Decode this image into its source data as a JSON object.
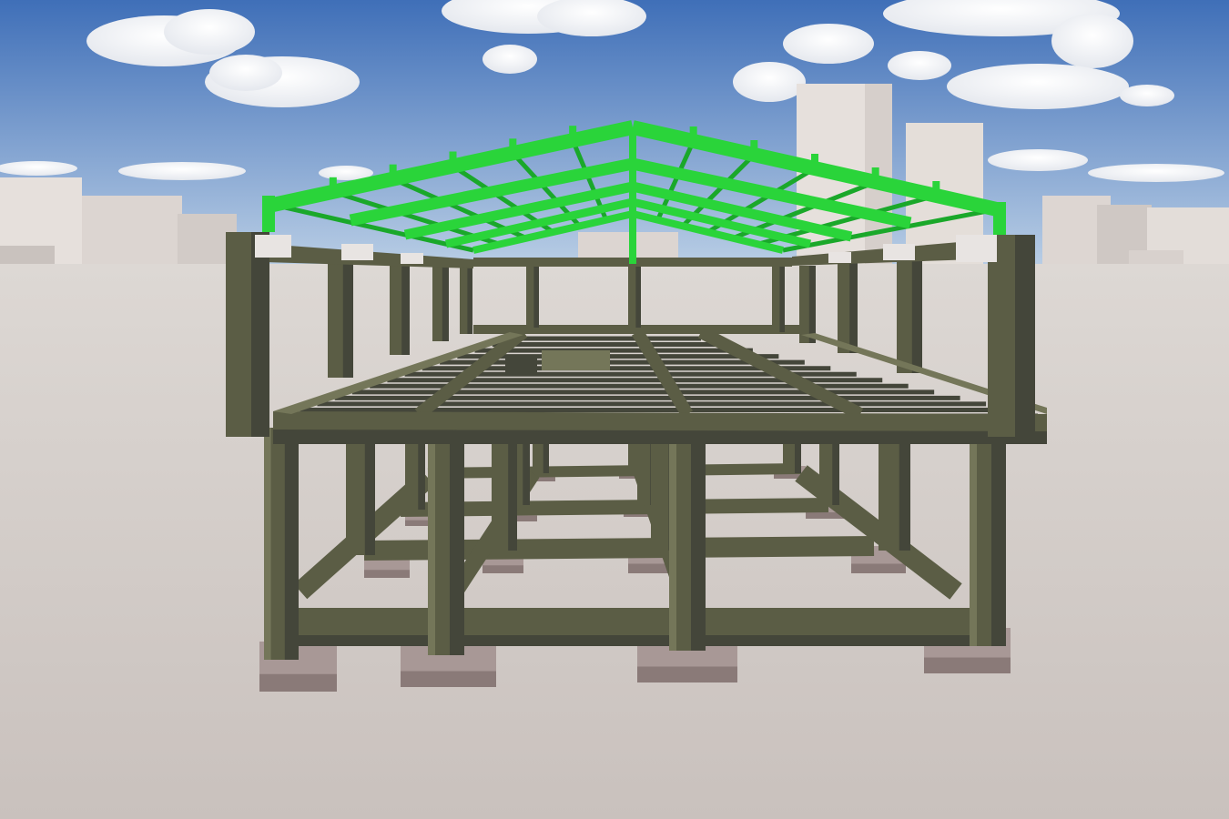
{
  "scene": {
    "colors": {
      "sky_top": "#3f6fb8",
      "sky_bottom": "#bcd0e6",
      "ground": "#c9c1bd",
      "ground_far": "#ddd8d4",
      "concrete": "#5b5d45",
      "concrete_dark": "#44463a",
      "concrete_light": "#747659",
      "footing": "#a89896",
      "footing_dark": "#8a7a78",
      "steel": "#2ad43a",
      "steel_dark": "#1aa82a",
      "building": "#e6e0dc",
      "building_shade": "#c9c2be"
    }
  }
}
